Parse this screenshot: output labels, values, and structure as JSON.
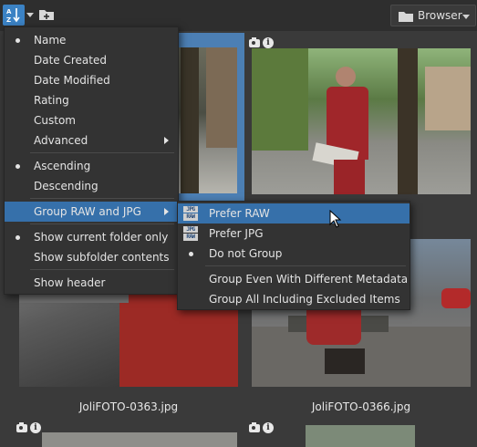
{
  "toolbar": {
    "browser_label": "Browser"
  },
  "grid": {
    "captions": [
      "JoliFOTO-0363.jpg",
      "JoliFOTO-0366.jpg"
    ]
  },
  "menu_main": {
    "items": [
      {
        "label": "Name",
        "checked": true
      },
      {
        "label": "Date Created",
        "checked": false
      },
      {
        "label": "Date Modified",
        "checked": false
      },
      {
        "label": "Rating",
        "checked": false
      },
      {
        "label": "Custom",
        "checked": false
      },
      {
        "label": "Advanced",
        "checked": false,
        "submenu": true
      },
      {
        "label": "Ascending",
        "checked": true
      },
      {
        "label": "Descending",
        "checked": false
      },
      {
        "label": "Group RAW and JPG",
        "checked": false,
        "submenu": true,
        "highlighted": true
      },
      {
        "label": "Show current folder only",
        "checked": true
      },
      {
        "label": "Show subfolder contents",
        "checked": false
      },
      {
        "label": "Show header",
        "checked": false
      }
    ]
  },
  "menu_group": {
    "items": [
      {
        "label": "Prefer RAW",
        "icon": "raw-over-jpg-icon",
        "highlighted": true
      },
      {
        "label": "Prefer JPG",
        "icon": "jpg-over-raw-icon"
      },
      {
        "label": "Do not Group",
        "checked": true
      },
      {
        "label": "Group Even With Different Metadata"
      },
      {
        "label": "Group All Including Excluded Items"
      }
    ],
    "icon_text": {
      "raw": "RAW",
      "jpg": "JPG"
    }
  },
  "colors": {
    "accent": "#3670aa",
    "selection": "#4c7fb4",
    "menu_bg": "#333333"
  }
}
